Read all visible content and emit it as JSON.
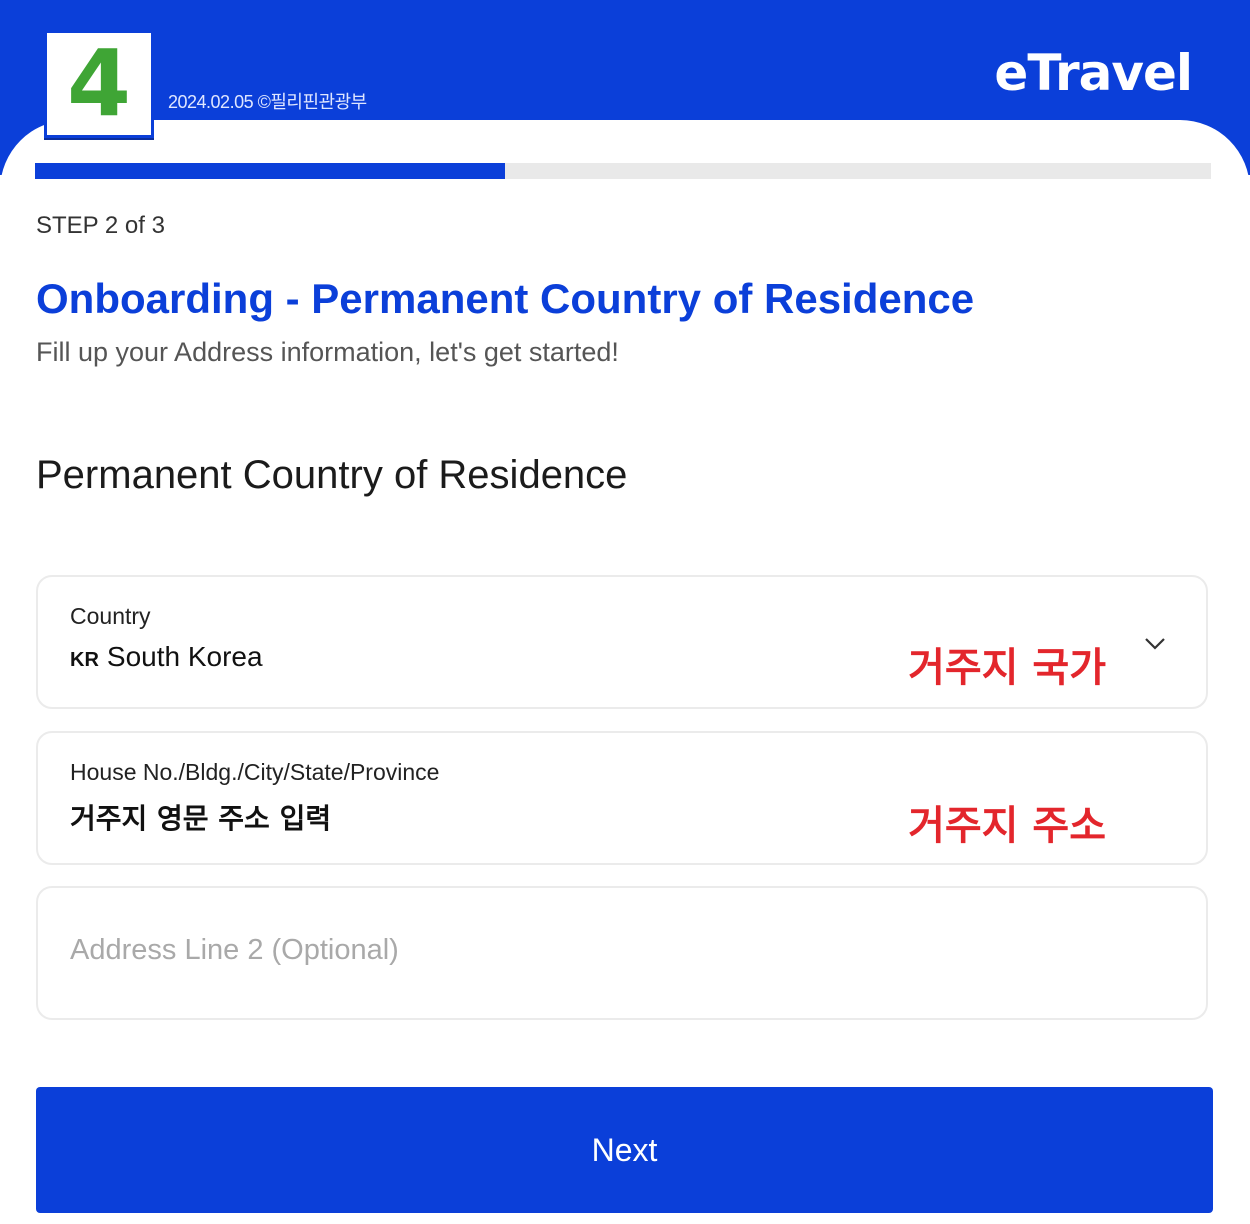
{
  "header": {
    "step_badge_number": "4",
    "date_text": "2024.02.05 ©필리핀관광부",
    "logo_text": "eTravel"
  },
  "progress": {
    "current_step": 2,
    "total_steps": 3,
    "fraction": 0.4
  },
  "step_label": "STEP 2 of 3",
  "title": "Onboarding - Permanent Country of Residence",
  "subtitle": "Fill up your Address information, let's get started!",
  "section_title": "Permanent Country of Residence",
  "fields": {
    "country": {
      "label": "Country",
      "country_code": "KR",
      "value": "South Korea",
      "annotation": "거주지 국가"
    },
    "address1": {
      "label": "House No./Bldg./City/State/Province",
      "value": "거주지 영문 주소 입력",
      "annotation": "거주지 주소"
    },
    "address2": {
      "placeholder": "Address Line 2 (Optional)"
    }
  },
  "next_button": {
    "label": "Next"
  },
  "colors": {
    "brand_blue": "#0b3fd9",
    "badge_green": "#3fa535",
    "annotation_red": "#e3262c"
  }
}
